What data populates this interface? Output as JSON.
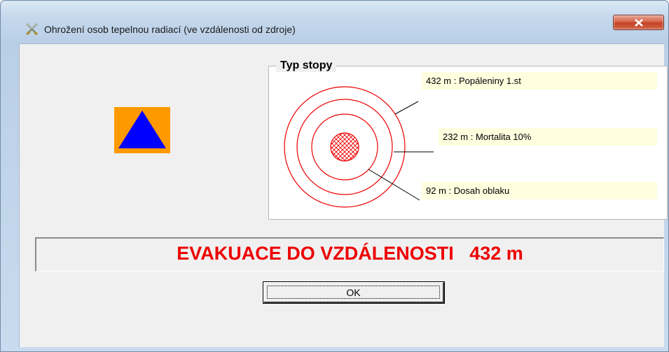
{
  "window": {
    "title": "Ohrožení osob tepelnou radiací (ve vzdálenosti od zdroje)",
    "close_icon": "close-x-icon",
    "app_icon": "crossed-swords-icon"
  },
  "hazard_symbol": {
    "icon": "civil-protection-triangle-icon",
    "square_color": "#ff9900",
    "triangle_color": "#0000ff"
  },
  "diagram": {
    "group_title": "Typ stopy",
    "ring_color": "#ee0000",
    "callout_background": "#ffffe0",
    "zones": [
      {
        "label": "432 m : Popáleniny 1.st"
      },
      {
        "label": "232 m : Mortalita 10%"
      },
      {
        "label": "92 m : Dosah oblaku"
      }
    ]
  },
  "banner": {
    "text": "EVAKUACE DO VZDÁLENOSTI   432 m",
    "color": "#ee0000"
  },
  "buttons": {
    "ok_label": "OK"
  }
}
